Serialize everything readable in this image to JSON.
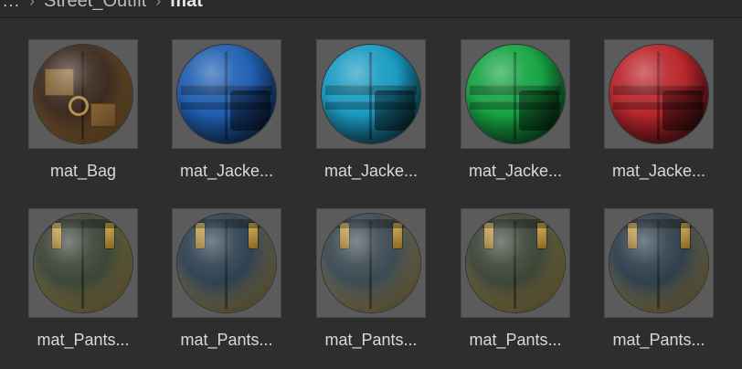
{
  "breadcrumb": {
    "items": [
      "…",
      "Street_Outfit",
      "mat"
    ]
  },
  "assets": [
    {
      "label": "mat_Bag",
      "base_color": "#3b2a1f",
      "accent": "#c08a3d",
      "kind": "bag"
    },
    {
      "label": "mat_Jacke...",
      "base_color": "#1f5fb2",
      "accent": "#0d1f3b",
      "kind": "jacket"
    },
    {
      "label": "mat_Jacke...",
      "base_color": "#1a9bc2",
      "accent": "#0a2b38",
      "kind": "jacket"
    },
    {
      "label": "mat_Jacke...",
      "base_color": "#17a444",
      "accent": "#083116",
      "kind": "jacket"
    },
    {
      "label": "mat_Jacke...",
      "base_color": "#b9262b",
      "accent": "#3b0c0f",
      "kind": "jacket"
    },
    {
      "label": "mat_Pants...",
      "base_color": "#3c4538",
      "accent": "#d1b05b",
      "kind": "pants"
    },
    {
      "label": "mat_Pants...",
      "base_color": "#2f4150",
      "accent": "#d1b05b",
      "kind": "pants"
    },
    {
      "label": "mat_Pants...",
      "base_color": "#3c4a53",
      "accent": "#d1b05b",
      "kind": "pants"
    },
    {
      "label": "mat_Pants...",
      "base_color": "#3d4538",
      "accent": "#d1b05b",
      "kind": "pants"
    },
    {
      "label": "mat_Pants...",
      "base_color": "#2f3f4c",
      "accent": "#d1b05b",
      "kind": "pants"
    }
  ]
}
